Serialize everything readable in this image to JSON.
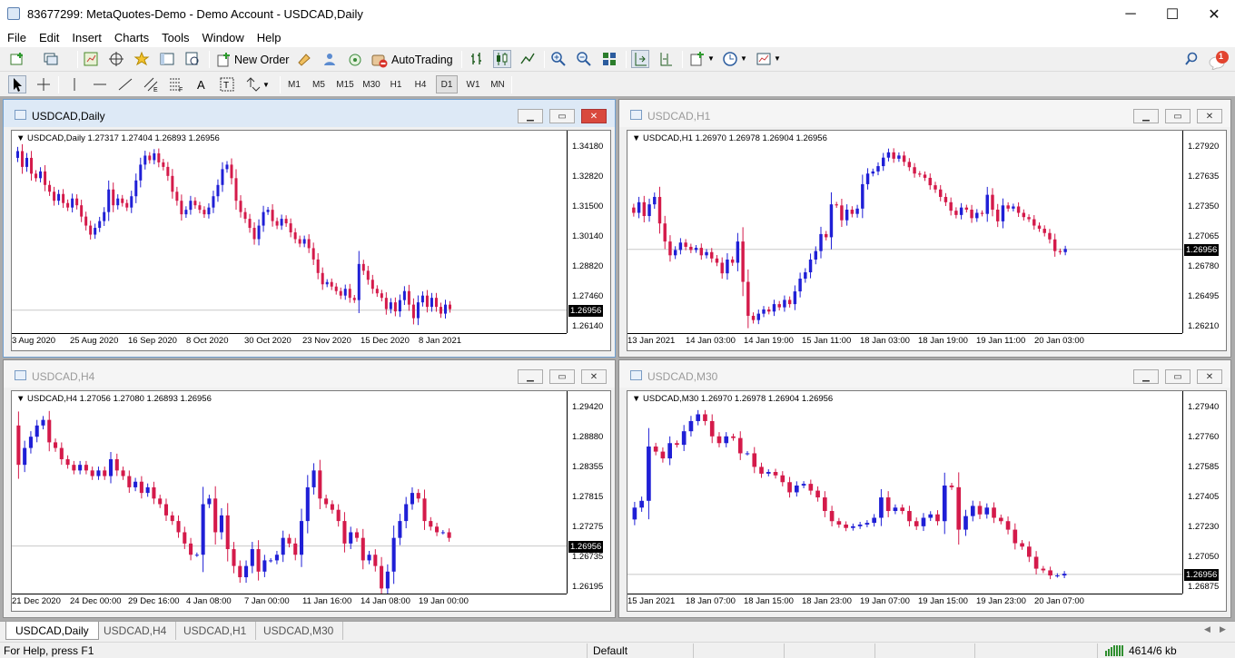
{
  "app": {
    "title": "83677299: MetaQuotes-Demo - Demo Account - USDCAD,Daily"
  },
  "window_controls": {
    "minimize": "─",
    "maximize": "☐",
    "close": "✕"
  },
  "menu": [
    "File",
    "Edit",
    "Insert",
    "Charts",
    "Tools",
    "Window",
    "Help"
  ],
  "toolbar": {
    "new_order": "New Order",
    "autotrading": "AutoTrading",
    "notification_count": "1"
  },
  "timeframes": [
    "M1",
    "M5",
    "M15",
    "M30",
    "H1",
    "H4",
    "D1",
    "W1",
    "MN"
  ],
  "active_timeframe": "D1",
  "colors": {
    "bull": "#1f1fd6",
    "bear": "#d41a4a",
    "price_line": "#c8c8c8",
    "active_caption": "#dde9f6"
  },
  "charts": [
    {
      "title": "USDCAD,Daily",
      "info": "USDCAD,Daily  1.27317 1.27404 1.26893 1.26956",
      "y_ticks": [
        "1.34180",
        "1.32820",
        "1.31500",
        "1.30140",
        "1.28820",
        "1.27460",
        "1.26140"
      ],
      "y_range": [
        1.2614,
        1.3418
      ],
      "price": "1.26956",
      "x_labels": [
        "3 Aug 2020",
        "25 Aug 2020",
        "16 Sep 2020",
        "8 Oct 2020",
        "30 Oct 2020",
        "23 Nov 2020",
        "15 Dec 2020",
        "8 Jan 2021"
      ],
      "path": [
        1.337,
        1.34,
        1.333,
        1.337,
        1.33,
        1.328,
        1.331,
        1.325,
        1.322,
        1.318,
        1.321,
        1.317,
        1.315,
        1.319,
        1.316,
        1.311,
        1.307,
        1.303,
        1.306,
        1.309,
        1.313,
        1.323,
        1.316,
        1.319,
        1.317,
        1.315,
        1.32,
        1.327,
        1.334,
        1.338,
        1.336,
        1.339,
        1.335,
        1.333,
        1.329,
        1.322,
        1.318,
        1.312,
        1.314,
        1.318,
        1.316,
        1.314,
        1.312,
        1.315,
        1.32,
        1.325,
        1.332,
        1.334,
        1.328,
        1.318,
        1.313,
        1.31,
        1.306,
        1.301,
        1.307,
        1.313,
        1.314,
        1.309,
        1.307,
        1.31,
        1.308,
        1.304,
        1.301,
        1.299,
        1.301,
        1.297,
        1.292,
        1.286,
        1.281,
        1.282,
        1.28,
        1.278,
        1.276,
        1.279,
        1.275,
        1.274,
        1.29,
        1.287,
        1.283,
        1.279,
        1.277,
        1.275,
        1.27,
        1.273,
        1.269,
        1.274,
        1.278,
        1.272,
        1.266,
        1.273,
        1.276,
        1.271,
        1.275,
        1.271,
        1.268,
        1.272,
        1.27
      ]
    },
    {
      "title": "USDCAD,H1",
      "info": "USDCAD,H1  1.26970 1.26978 1.26904 1.26956",
      "y_ticks": [
        "1.27920",
        "1.27635",
        "1.27350",
        "1.27065",
        "1.26780",
        "1.26495",
        "1.26210"
      ],
      "y_range": [
        1.2621,
        1.2792
      ],
      "price": "1.26956",
      "x_labels": [
        "13 Jan 2021",
        "14 Jan 03:00",
        "14 Jan 19:00",
        "15 Jan 11:00",
        "18 Jan 03:00",
        "18 Jan 19:00",
        "19 Jan 11:00",
        "20 Jan 03:00"
      ],
      "path": [
        1.2735,
        1.273,
        1.274,
        1.2727,
        1.2738,
        1.2745,
        1.272,
        1.2703,
        1.269,
        1.2695,
        1.2702,
        1.2698,
        1.2695,
        1.2697,
        1.269,
        1.2693,
        1.2687,
        1.2683,
        1.2673,
        1.2686,
        1.2683,
        1.2703,
        1.2665,
        1.2633,
        1.2629,
        1.2635,
        1.2639,
        1.2637,
        1.2644,
        1.2641,
        1.2648,
        1.2644,
        1.2656,
        1.2668,
        1.2674,
        1.2686,
        1.2694,
        1.271,
        1.2707,
        1.2738,
        1.2737,
        1.2723,
        1.2733,
        1.2729,
        1.2734,
        1.2757,
        1.2767,
        1.2769,
        1.2774,
        1.2782,
        1.2787,
        1.2781,
        1.2784,
        1.2778,
        1.2773,
        1.2767,
        1.2766,
        1.2763,
        1.2756,
        1.2752,
        1.2745,
        1.274,
        1.2732,
        1.2728,
        1.2735,
        1.2733,
        1.2725,
        1.273,
        1.2729,
        1.2747,
        1.2733,
        1.2722,
        1.2737,
        1.2734,
        1.2736,
        1.273,
        1.2726,
        1.2724,
        1.2718,
        1.2715,
        1.2711,
        1.2705,
        1.2694,
        1.2693,
        1.2696
      ]
    },
    {
      "title": "USDCAD,H4",
      "info": "USDCAD,H4  1.27056 1.27080 1.26893 1.26956",
      "y_ticks": [
        "1.29420",
        "1.28880",
        "1.28355",
        "1.27815",
        "1.27275",
        "1.26735",
        "1.26195"
      ],
      "y_range": [
        1.2619,
        1.2942
      ],
      "price": "1.26956",
      "x_labels": [
        "21 Dec 2020",
        "24 Dec 00:00",
        "29 Dec 16:00",
        "4 Jan 08:00",
        "7 Jan 00:00",
        "11 Jan 16:00",
        "14 Jan 08:00",
        "19 Jan 00:00"
      ],
      "path": [
        1.291,
        1.284,
        1.287,
        1.289,
        1.291,
        1.292,
        1.288,
        1.287,
        1.285,
        1.284,
        1.283,
        1.284,
        1.283,
        1.282,
        1.283,
        1.282,
        1.285,
        1.283,
        1.282,
        1.28,
        1.281,
        1.279,
        1.28,
        1.278,
        1.277,
        1.275,
        1.274,
        1.272,
        1.27,
        1.268,
        1.268,
        1.277,
        1.278,
        1.272,
        1.275,
        1.269,
        1.266,
        1.264,
        1.266,
        1.269,
        1.265,
        1.267,
        1.267,
        1.268,
        1.271,
        1.27,
        1.268,
        1.274,
        1.28,
        1.283,
        1.278,
        1.277,
        1.276,
        1.274,
        1.27,
        1.272,
        1.271,
        1.267,
        1.268,
        1.266,
        1.262,
        1.265,
        1.271,
        1.274,
        1.277,
        1.279,
        1.278,
        1.274,
        1.273,
        1.272,
        1.272,
        1.271
      ]
    },
    {
      "title": "USDCAD,M30",
      "info": "USDCAD,M30  1.26970 1.26978 1.26904 1.26956",
      "y_ticks": [
        "1.27940",
        "1.27760",
        "1.27585",
        "1.27405",
        "1.27230",
        "1.27050",
        "1.26875"
      ],
      "y_range": [
        1.2687,
        1.2794
      ],
      "price": "1.26956",
      "x_labels": [
        "15 Jan 2021",
        "18 Jan 07:00",
        "18 Jan 15:00",
        "18 Jan 23:00",
        "19 Jan 07:00",
        "19 Jan 15:00",
        "19 Jan 23:00",
        "20 Jan 07:00"
      ],
      "path": [
        1.2728,
        1.2735,
        1.2739,
        1.2771,
        1.2768,
        1.2764,
        1.2773,
        1.2772,
        1.278,
        1.2786,
        1.279,
        1.2786,
        1.2777,
        1.2773,
        1.2777,
        1.2776,
        1.2767,
        1.2767,
        1.2759,
        1.2755,
        1.2756,
        1.2754,
        1.275,
        1.2744,
        1.2748,
        1.2749,
        1.2745,
        1.2741,
        1.2733,
        1.2727,
        1.2725,
        1.2723,
        1.2724,
        1.2725,
        1.2726,
        1.2729,
        1.2741,
        1.2733,
        1.2735,
        1.2733,
        1.2727,
        1.2724,
        1.2729,
        1.2731,
        1.2727,
        1.2748,
        1.2747,
        1.2722,
        1.273,
        1.2736,
        1.2731,
        1.2735,
        1.2729,
        1.2727,
        1.2722,
        1.2714,
        1.2712,
        1.2706,
        1.2699,
        1.2698,
        1.2695,
        1.2695,
        1.2696
      ]
    }
  ],
  "tabs": [
    "USDCAD,Daily",
    "USDCAD,H4",
    "USDCAD,H1",
    "USDCAD,M30"
  ],
  "active_tab": "USDCAD,Daily",
  "status": {
    "help": "For Help, press F1",
    "profile": "Default",
    "traffic": "4614/6 kb"
  }
}
